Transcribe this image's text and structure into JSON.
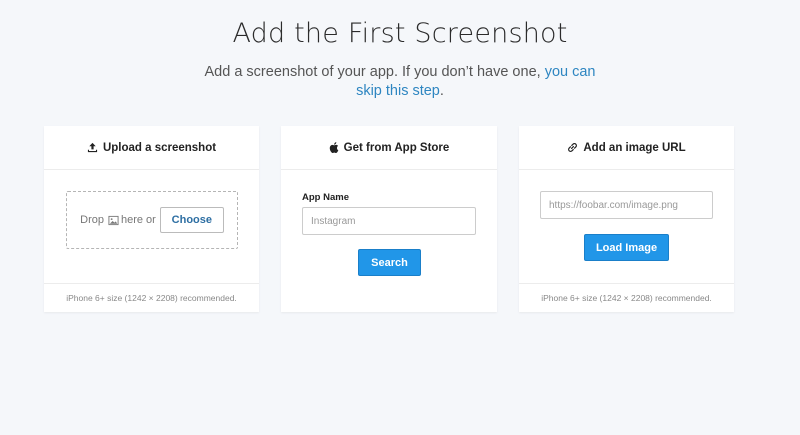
{
  "header": {
    "title": "Add the First Screenshot",
    "subtitle_text": "Add a screenshot of your app. If you don’t have one, ",
    "subtitle_link": "you can skip this step",
    "subtitle_end": "."
  },
  "cards": {
    "upload": {
      "heading": "Upload a screenshot",
      "icon": "upload-icon",
      "drop_before": "Drop",
      "drop_icon": "image-icon",
      "drop_after": "here or",
      "choose_label": "Choose",
      "footer": "iPhone 6+ size (1242 × 2208) recommended."
    },
    "appstore": {
      "heading": "Get from App Store",
      "icon": "apple-icon",
      "field_label": "App Name",
      "field_placeholder": "Instagram",
      "search_label": "Search"
    },
    "url": {
      "heading": "Add an image URL",
      "icon": "link-icon",
      "field_placeholder": "https://foobar.com/image.png",
      "load_label": "Load Image",
      "footer": "iPhone 6+ size (1242 × 2208) recommended."
    }
  },
  "colors": {
    "background": "#f5f7fa",
    "link": "#2e86c1",
    "primary_button": "#2196e8"
  }
}
